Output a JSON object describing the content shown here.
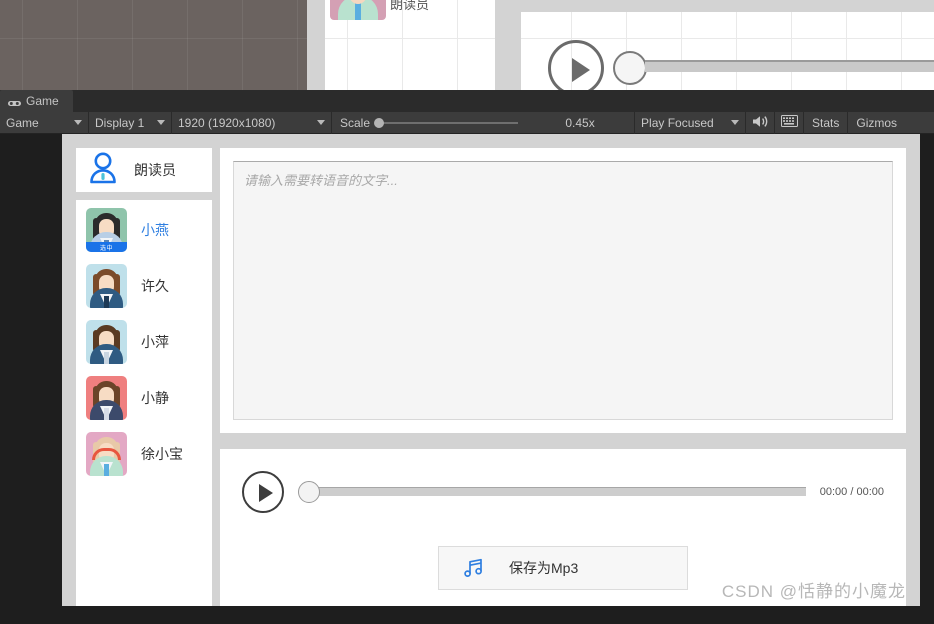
{
  "editor": {
    "tab": {
      "label": "Game",
      "icon": "gamepad-icon"
    },
    "toolbar": {
      "view_dropdown": "Game",
      "display_dropdown": "Display 1",
      "resolution_dropdown": "1920 (1920x1080)",
      "scale_label": "Scale",
      "scale_value": "0.45x",
      "play_mode_dropdown": "Play Focused",
      "mute_icon": "speaker-icon",
      "aspect_icon": "grid-icon",
      "stats_label": "Stats",
      "gizmos_label": "Gizmos"
    }
  },
  "app": {
    "sidebar": {
      "header": {
        "label": "朗读员",
        "icon": "person-outline-icon"
      },
      "voices": [
        {
          "name": "小燕",
          "selected": true,
          "badge": "选中",
          "bg": "#8fc4ab",
          "hair": "#2b2b2b",
          "suit": "#b9cfe6",
          "tie": "#5b85b5"
        },
        {
          "name": "许久",
          "selected": false,
          "badge": "",
          "bg": "#bfe0ea",
          "hair": "#7b4b2a",
          "suit": "#2f5b82",
          "tie": "#1e3a56"
        },
        {
          "name": "小萍",
          "selected": false,
          "badge": "",
          "bg": "#bfe0ea",
          "hair": "#5a3a22",
          "suit": "#2f5b82",
          "tie": "#c9d6e2"
        },
        {
          "name": "小静",
          "selected": false,
          "badge": "",
          "bg": "#ef7f7f",
          "hair": "#6b4429",
          "suit": "#3c4a6b",
          "tie": "#d8dde8"
        },
        {
          "name": "徐小宝",
          "selected": false,
          "badge": "",
          "bg": "#e3a8c4",
          "hair": "#e8c9a8",
          "suit": "#b9e2cf",
          "tie": "#5aaee0"
        }
      ]
    },
    "text_input": {
      "value": "",
      "placeholder": "请输入需要转语音的文字..."
    },
    "player": {
      "play_icon": "play-icon",
      "progress_percent": 0,
      "time_display": "00:00 / 00:00"
    },
    "save_button": {
      "label": "保存为Mp3",
      "icon": "music-note-icon",
      "icon_color": "#2f7fe0"
    }
  },
  "watermark": "CSDN @恬静的小魔龙",
  "scene": {
    "label": "朗读员"
  }
}
